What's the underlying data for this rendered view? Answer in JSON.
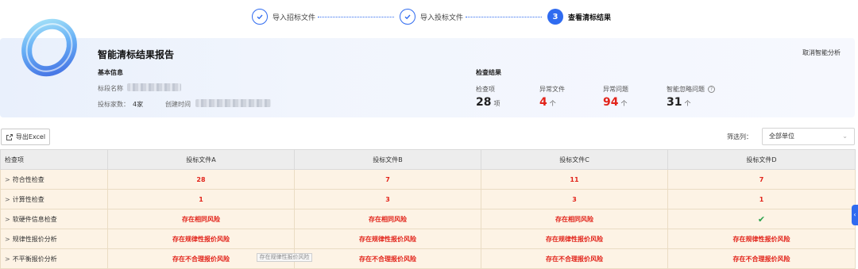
{
  "stepper": {
    "steps": [
      {
        "label": "导入招标文件",
        "state": "done"
      },
      {
        "label": "导入投标文件",
        "state": "done"
      },
      {
        "label": "查看清标结果",
        "state": "active",
        "number": "3"
      }
    ]
  },
  "report": {
    "title": "智能清标结果报告",
    "cancel_label": "取消智能分析",
    "basic_info": {
      "title": "基本信息",
      "section_name_label": "标段名称",
      "bidder_count_label": "投标家数：",
      "bidder_count_value": "4家",
      "created_time_label": "创建时间"
    },
    "results": {
      "title": "检查结果",
      "metrics": [
        {
          "label": "检查项",
          "value": "28",
          "unit": "项",
          "color": "#222222"
        },
        {
          "label": "异常文件",
          "value": "4",
          "unit": "个",
          "color": "#e2231a"
        },
        {
          "label": "异常问题",
          "value": "94",
          "unit": "个",
          "color": "#e2231a"
        },
        {
          "label": "智能忽略问题",
          "value": "31",
          "unit": "个",
          "color": "#222222"
        }
      ]
    }
  },
  "toolbar": {
    "export_label": "导出Excel",
    "filter_label": "筛选列：",
    "filter_value": "全部单位"
  },
  "table": {
    "headers": [
      "检查项",
      "投标文件A",
      "投标文件B",
      "投标文件C",
      "投标文件D"
    ],
    "rows": [
      {
        "item": "符合性检查",
        "cells": [
          "28",
          "7",
          "11",
          "7"
        ]
      },
      {
        "item": "计算性检查",
        "cells": [
          "1",
          "3",
          "3",
          "1"
        ]
      },
      {
        "item": "软硬件信息检查",
        "cells": [
          "存在相同风险",
          "存在相同风险",
          "存在相同风险",
          "✔"
        ]
      },
      {
        "item": "规律性报价分析",
        "cells": [
          "存在规律性报价风险",
          "存在规律性报价风险",
          "存在规律性报价风险",
          "存在规律性报价风险"
        ]
      },
      {
        "item": "不平衡报价分析",
        "cells": [
          "存在不合理报价风险",
          "存在不合理报价风险",
          "存在不合理报价风险",
          "存在不合理报价风险"
        ]
      }
    ]
  },
  "tooltip": {
    "text": "存在规律性报价风险"
  },
  "colors": {
    "accent": "#2f6bf0",
    "danger": "#e2231a",
    "ok": "#2ba24c",
    "row_bg": "#fdf3e5"
  }
}
